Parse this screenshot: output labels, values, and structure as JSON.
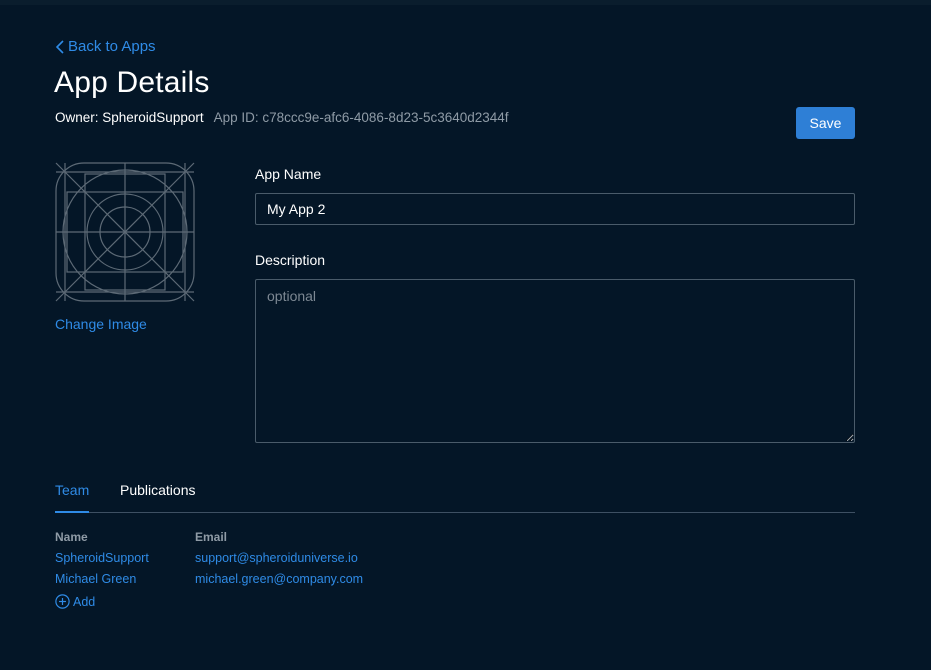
{
  "nav": {
    "back_label": "Back to Apps"
  },
  "header": {
    "title": "App Details",
    "owner_label": "Owner: SpheroidSupport",
    "app_id_label": "App ID: c78ccc9e-afc6-4086-8d23-5c3640d2344f",
    "save_label": "Save"
  },
  "image": {
    "change_label": "Change Image"
  },
  "form": {
    "name_label": "App Name",
    "name_value": "My App 2",
    "description_label": "Description",
    "description_placeholder": "optional"
  },
  "tabs": [
    {
      "label": "Team",
      "active": true
    },
    {
      "label": "Publications",
      "active": false
    }
  ],
  "team": {
    "columns": [
      "Name",
      "Email"
    ],
    "rows": [
      {
        "name": "SpheroidSupport",
        "email": "support@spheroiduniverse.io"
      },
      {
        "name": "Michael Green",
        "email": "michael.green@company.com"
      }
    ],
    "add_label": "Add"
  },
  "colors": {
    "background": "#041627",
    "accent": "#2f8be6",
    "button": "#2e7fd6",
    "muted_text": "#8f9ba6",
    "border": "#4a5b6a"
  },
  "icons": {
    "back": "chevron-left-icon",
    "app_placeholder": "app-icon-placeholder",
    "add": "plus-circle-icon"
  }
}
